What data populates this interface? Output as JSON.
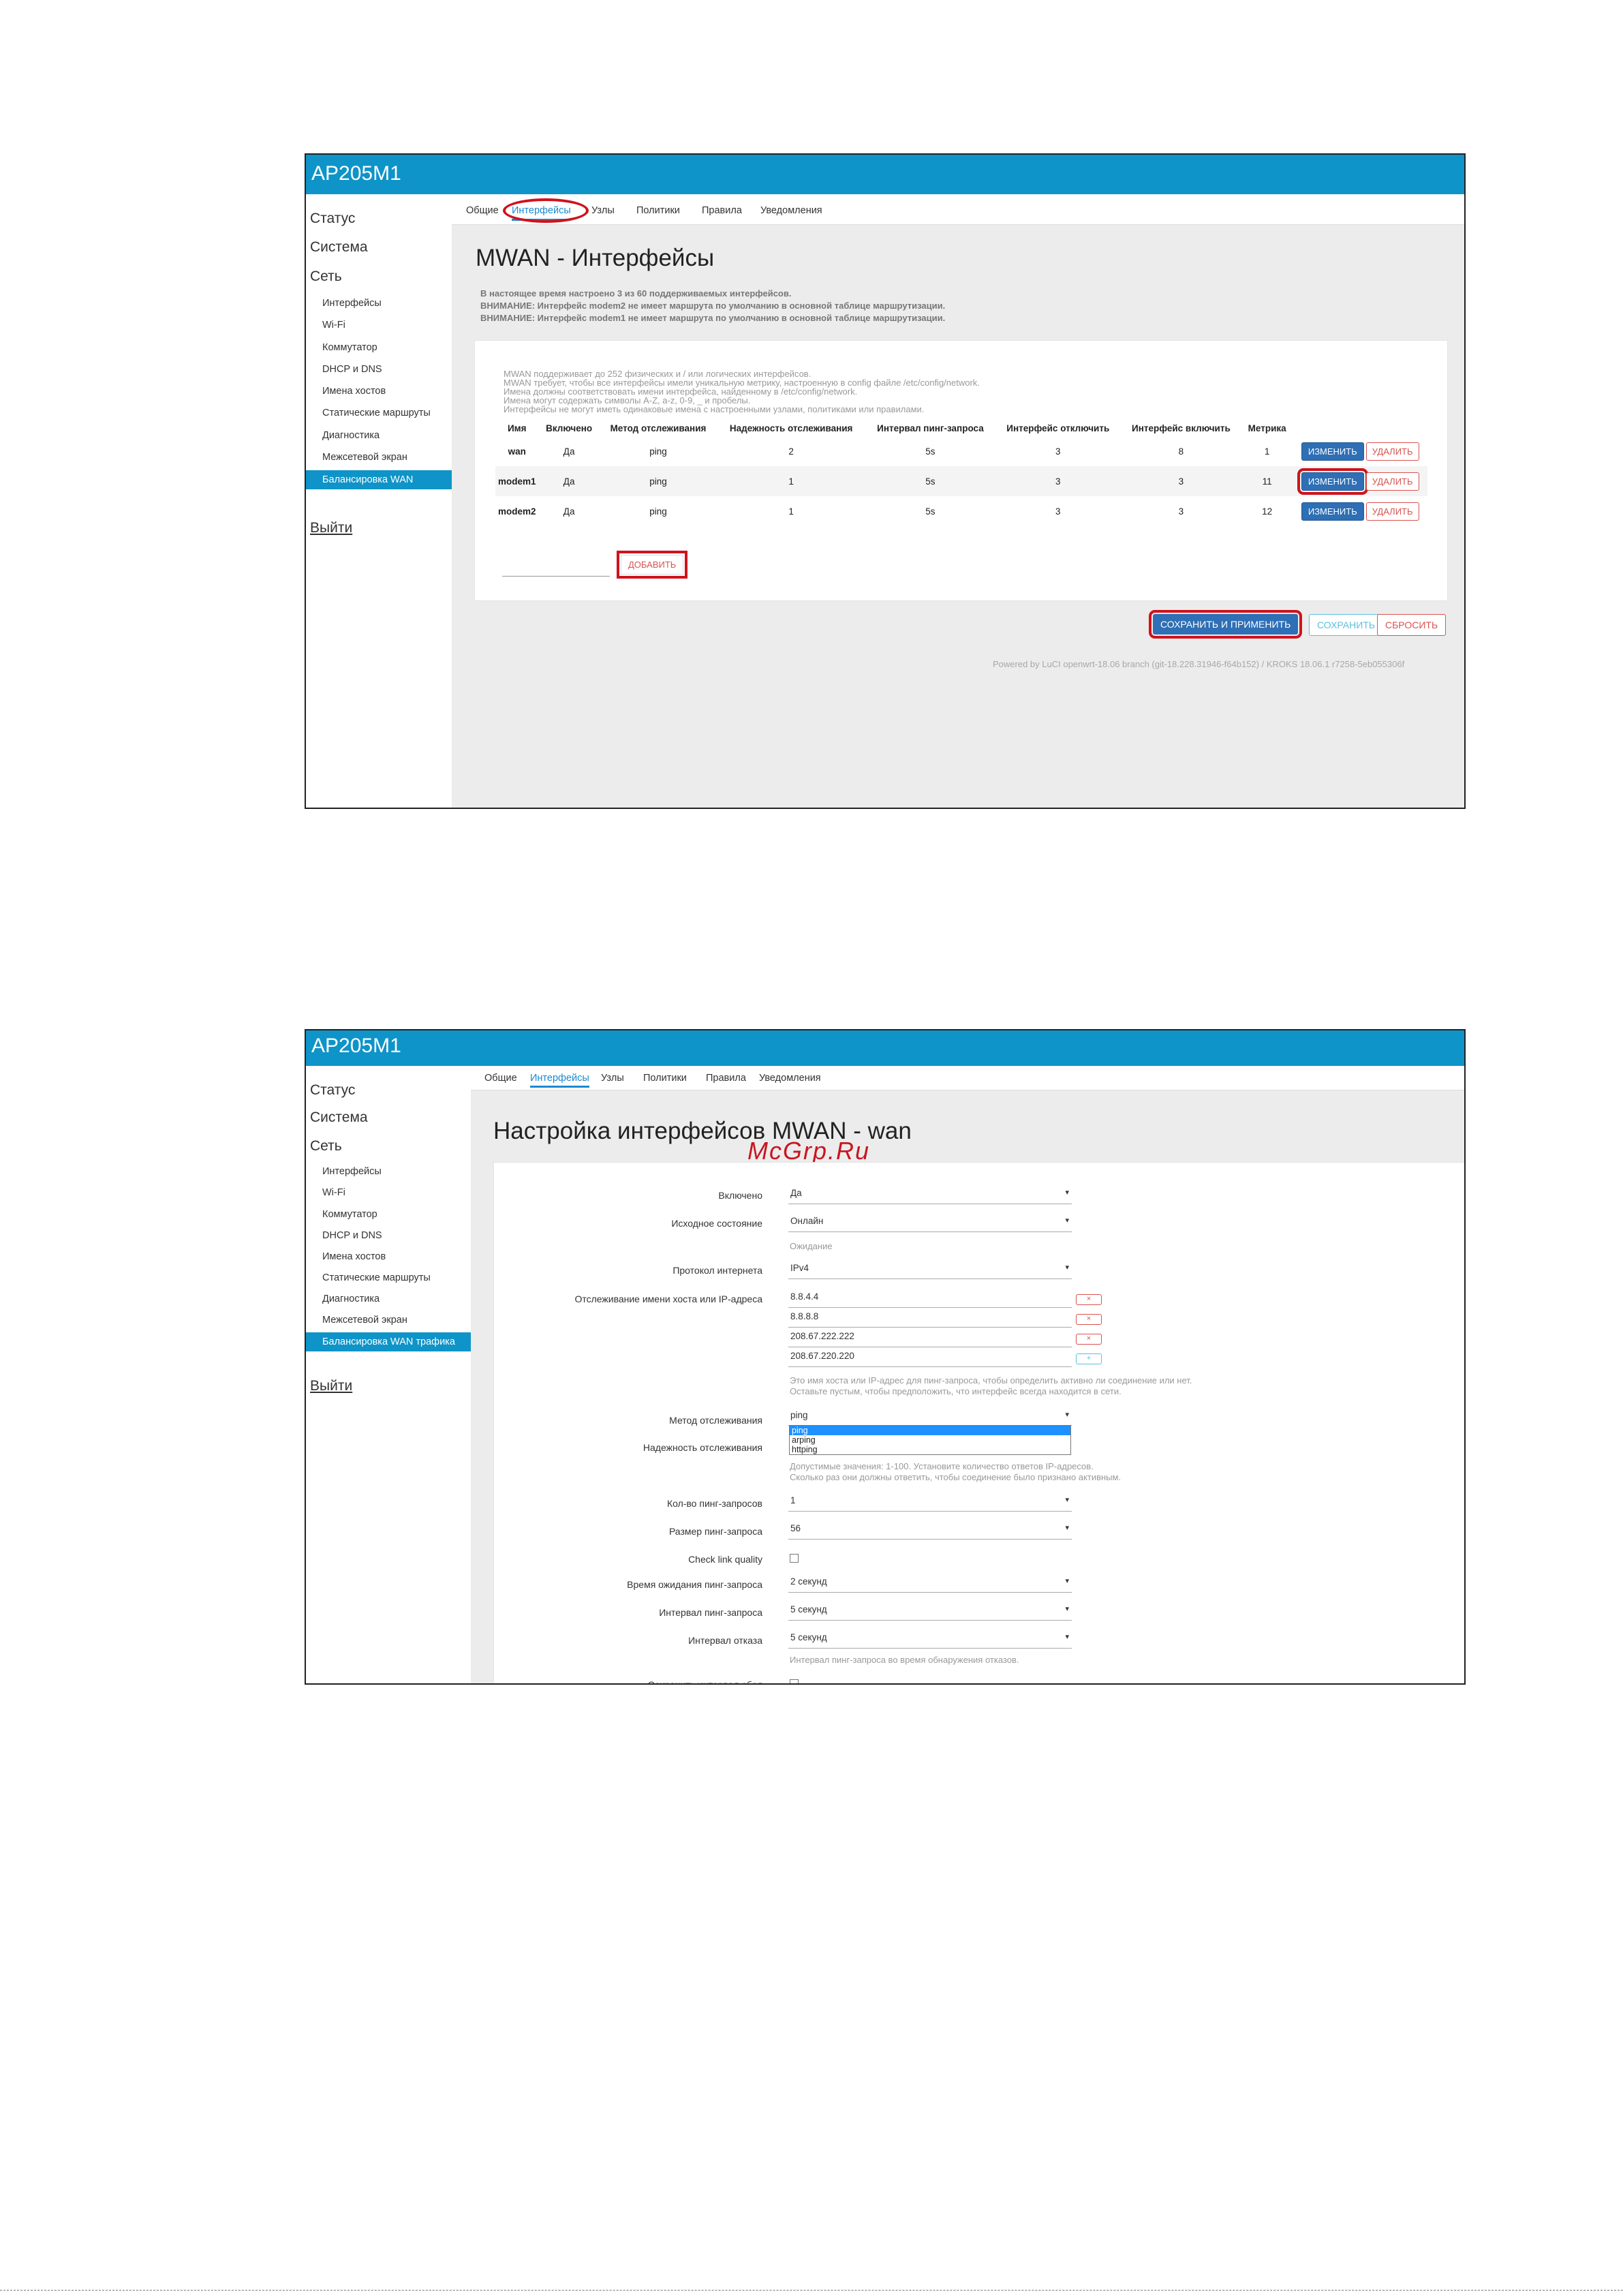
{
  "s1": {
    "title": "AP205M1",
    "sidebar": {
      "status": "Статус",
      "system": "Система",
      "network": "Сеть",
      "items": [
        "Интерфейсы",
        "Wi-Fi",
        "Коммутатор",
        "DHCP и DNS",
        "Имена хостов",
        "Статические маршруты",
        "Диагностика",
        "Межсетевой экран",
        "Балансировка WAN трафика"
      ],
      "logout": "Выйти"
    },
    "tabs": [
      "Общие",
      "Интерфейсы",
      "Узлы",
      "Политики",
      "Правила",
      "Уведомления"
    ],
    "heading": "MWAN - Интерфейсы",
    "warnings": [
      "В настоящее время настроено 3 из 60 поддерживаемых интерфейсов.",
      "ВНИМАНИЕ: Интерфейс modem2 не имеет маршрута по умолчанию в основной таблице маршрутизации.",
      "ВНИМАНИЕ: Интерфейс modem1 не имеет маршрута по умолчанию в основной таблице маршрутизации."
    ],
    "hints": [
      "MWAN поддерживает до 252 физических и / или логических интерфейсов.",
      "MWAN требует, чтобы все интерфейсы имели уникальную метрику, настроенную в config файле /etc/config/network.",
      "Имена должны соответствовать имени интерфейса, найденному в /etc/config/network.",
      "Имена могут содержать символы A-Z, a-z, 0-9, _ и пробелы.",
      "Интерфейсы не могут иметь одинаковые имена с настроенными узлами, политиками или правилами."
    ],
    "table": {
      "headers": [
        "Имя",
        "Включено",
        "Метод отслеживания",
        "Надежность отслеживания",
        "Интервал пинг-запроса",
        "Интерфейс отключить",
        "Интерфейс включить",
        "Метрика"
      ],
      "rows": [
        [
          "wan",
          "Да",
          "ping",
          "2",
          "5s",
          "3",
          "8",
          "1"
        ],
        [
          "modem1",
          "Да",
          "ping",
          "1",
          "5s",
          "3",
          "3",
          "11"
        ],
        [
          "modem2",
          "Да",
          "ping",
          "1",
          "5s",
          "3",
          "3",
          "12"
        ]
      ],
      "edit_label": "ИЗМЕНИТЬ",
      "delete_label": "УДАЛИТЬ"
    },
    "add_label": "ДОБАВИТЬ",
    "save_apply": "СОХРАНИТЬ И ПРИМЕНИТЬ",
    "save": "СОХРАНИТЬ",
    "reset": "СБРОСИТЬ",
    "footer": "Powered by LuCI openwrt-18.06 branch (git-18.228.31946-f64b152) / KROKS 18.06.1 r7258-5eb055306f"
  },
  "s2": {
    "title": "AP205M1",
    "sidebar": {
      "status": "Статус",
      "system": "Система",
      "network": "Сеть",
      "items": [
        "Интерфейсы",
        "Wi-Fi",
        "Коммутатор",
        "DHCP и DNS",
        "Имена хостов",
        "Статические маршруты",
        "Диагностика",
        "Межсетевой экран",
        "Балансировка WAN трафика"
      ],
      "logout": "Выйти"
    },
    "tabs": [
      "Общие",
      "Интерфейсы",
      "Узлы",
      "Политики",
      "Правила",
      "Уведомления"
    ],
    "heading": "Настройка интерфейсов MWAN - wan",
    "watermark": "McGrp.Ru",
    "form": {
      "enabled_label": "Включено",
      "enabled_value": "Да",
      "initial_label": "Исходное состояние",
      "initial_value": "Онлайн",
      "initial_hint": "Ожидание",
      "proto_label": "Протокол интернета",
      "proto_value": "IPv4",
      "track_ip_label": "Отслеживание имени хоста или IP-адреса",
      "track_ips": [
        "8.8.4.4",
        "8.8.8.8",
        "208.67.222.222",
        "208.67.220.220"
      ],
      "track_hint": [
        "Это имя хоста или IP-адрес для пинг-запроса, чтобы определить активно ли соединение или нет.",
        "Оставьте пустым, чтобы предположить, что интерфейс всегда находится в сети."
      ],
      "method_label": "Метод отслеживания",
      "method_value": "ping",
      "method_options": [
        "ping",
        "arping",
        "httping"
      ],
      "reliability_label": "Надежность отслеживания",
      "reliability_hint": [
        "Допустимые значения: 1-100. Установите количество ответов IP-адресов.",
        "Сколько раз они должны ответить, чтобы соединение было признано активным."
      ],
      "count_label": "Кол-во пинг-запросов",
      "count_value": "1",
      "size_label": "Размер пинг-запроса",
      "size_value": "56",
      "quality_label": "Check link quality",
      "timeout_label": "Время ожидания пинг-запроса",
      "timeout_value": "2 секунд",
      "interval_label": "Интервал пинг-запроса",
      "interval_value": "5 секунд",
      "failure_label": "Интервал отказа",
      "failure_value": "5 секунд",
      "failure_hint": "Интервал пинг-запроса во время обнаружения отказов.",
      "keep_label": "Сохранить интервал сбоя"
    }
  },
  "remove_symbol": "×",
  "add_symbol": "+",
  "arrow_symbol": "▾"
}
